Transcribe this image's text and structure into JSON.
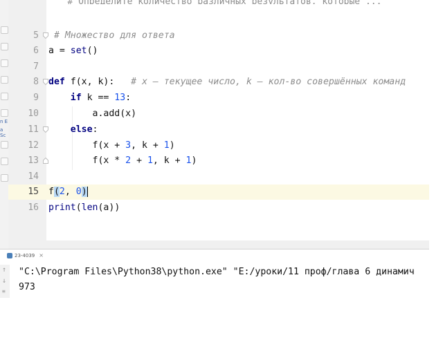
{
  "top_cut_text": "   # Определите количество различных результатов, которые ...",
  "editor": {
    "lines": [
      {
        "n": "5",
        "html_key": "l5"
      },
      {
        "n": "6",
        "html_key": "l6"
      },
      {
        "n": "7",
        "html_key": "l7"
      },
      {
        "n": "8",
        "html_key": "l8"
      },
      {
        "n": "9",
        "html_key": "l9"
      },
      {
        "n": "10",
        "html_key": "l10"
      },
      {
        "n": "11",
        "html_key": "l11"
      },
      {
        "n": "12",
        "html_key": "l12"
      },
      {
        "n": "13",
        "html_key": "l13"
      },
      {
        "n": "14",
        "html_key": "l14"
      },
      {
        "n": "15",
        "html_key": "l15"
      },
      {
        "n": "16",
        "html_key": "l16"
      }
    ],
    "code": {
      "l5_comment": "# Множество для ответа",
      "l6_a": "a = ",
      "l6_set": "set",
      "l6_paren": "()",
      "l8_def": "def",
      "l8_sig": " f(x, k):   ",
      "l8_comment": "# x — текущее число, k — кол-во совершённых команд",
      "l9_if": "if",
      "l9_cond": " k == ",
      "l9_num": "13",
      "l9_colon": ":",
      "l10_code": "a.add(x)",
      "l11_else": "else",
      "l11_colon": ":",
      "l12_a": "f(x + ",
      "l12_n1": "3",
      "l12_b": ", k + ",
      "l12_n2": "1",
      "l12_c": ")",
      "l13_a": "f(x * ",
      "l13_n1": "2",
      "l13_b": " + ",
      "l13_n2": "1",
      "l13_c": ", k + ",
      "l13_n3": "1",
      "l13_d": ")",
      "l15_f": "f",
      "l15_open": "(",
      "l15_n1": "2",
      "l15_comma": ", ",
      "l15_n2": "0",
      "l15_close": ")",
      "l16_print": "print",
      "l16_open": "(",
      "l16_len": "len",
      "l16_rest": "(a)",
      "l16_close": ")"
    }
  },
  "left_strip": {
    "label_1": "n E",
    "label_2": "a Sc"
  },
  "run_panel": {
    "tab_label": "23-4039",
    "tab_close": "×",
    "command": "\"C:\\Program Files\\Python38\\python.exe\" \"E:/уроки/11 проф/глава 6 динамич",
    "output": "973",
    "rerun_icon": "↑",
    "down_icon": "↓",
    "wrap_icon": "≡"
  }
}
